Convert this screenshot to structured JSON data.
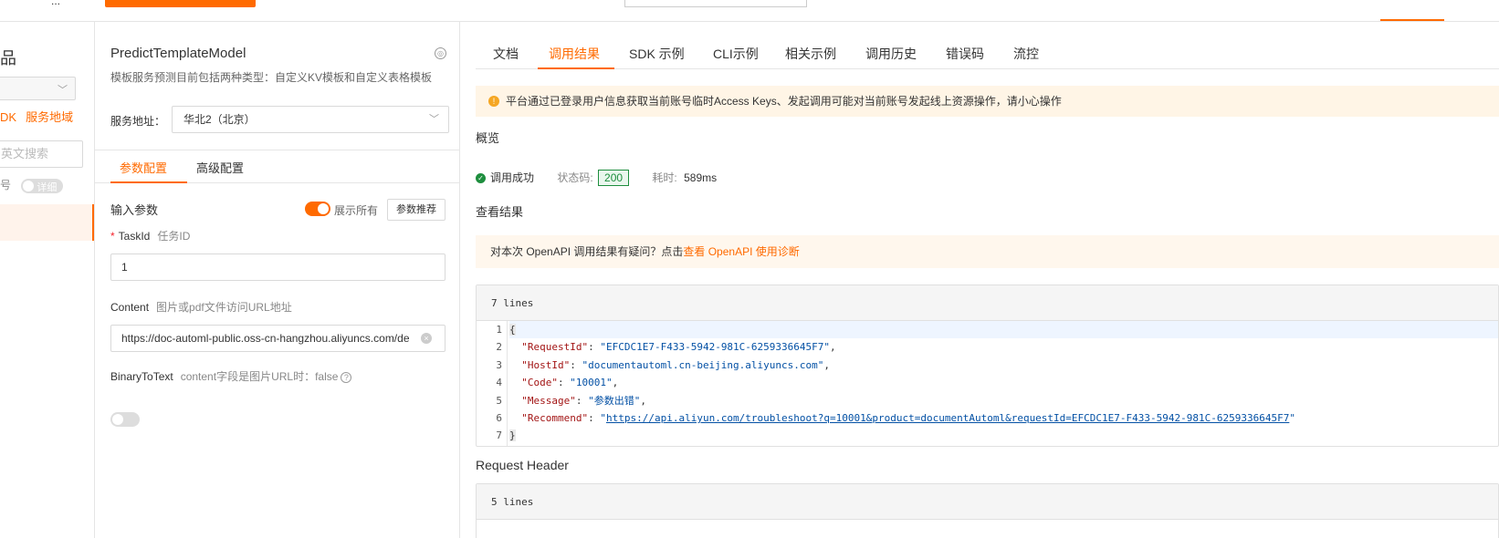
{
  "topbar": {
    "stub_text": "..."
  },
  "left": {
    "title_glyph": "品",
    "link_sdk": "DK",
    "link_region": "服务地域",
    "search_placeholder": "英文搜索",
    "toggle_left_label": "号",
    "toggle_label": "详细"
  },
  "api": {
    "name": "PredictTemplateModel",
    "description": "模板服务预测目前包括两种类型：自定义KV模板和自定义表格模板",
    "address_label": "服务地址：",
    "address_value": "华北2（北京）"
  },
  "param_tabs": {
    "params": "参数配置",
    "advanced": "高级配置"
  },
  "inputs": {
    "section_label": "输入参数",
    "show_all": "展示所有",
    "recommend": "参数推荐",
    "task_id": {
      "name": "TaskId",
      "hint": "任务ID",
      "value": "1"
    },
    "content": {
      "name": "Content",
      "hint": "图片或pdf文件访问URL地址",
      "value": "https://doc-automl-public.oss-cn-hangzhou.aliyuncs.com/de"
    },
    "binary": {
      "name": "BinaryToText",
      "hint": "content字段是图片URL时：false"
    }
  },
  "result_tabs": [
    "文档",
    "调用结果",
    "SDK 示例",
    "CLI示例",
    "相关示例",
    "调用历史",
    "错误码",
    "流控"
  ],
  "warning": "平台通过已登录用户信息获取当前账号临时Access Keys、发起调用可能对当前账号发起线上资源操作，请小心操作",
  "overview": {
    "title": "概览",
    "status": "调用成功",
    "status_code_label": "状态码:",
    "status_code": "200",
    "time_label": "耗时:",
    "time": "589ms"
  },
  "result": {
    "title": "查看结果",
    "hint_prefix": "对本次 OpenAPI 调用结果有疑问？点击",
    "hint_link": "查看 OpenAPI 使用诊断",
    "lines_label": "7 lines",
    "json": {
      "RequestId": "EFCDC1E7-F433-5942-981C-6259336645F7",
      "HostId": "documentautoml.cn-beijing.aliyuncs.com",
      "Code": "10001",
      "Message": "参数出错",
      "Recommend": "https://api.aliyun.com/troubleshoot?q=10001&product=documentAutoml&requestId=EFCDC1E7-F433-5942-981C-6259336645F7"
    }
  },
  "request_header": {
    "title": "Request Header",
    "lines_label": "5 lines"
  },
  "line_numbers": [
    "1",
    "2",
    "3",
    "4",
    "5",
    "6",
    "7"
  ],
  "colors": {
    "accent": "#ff6a00",
    "success": "#1e8e3e",
    "warning": "#f5a623"
  },
  "icons": [
    "chevron-down-icon",
    "api-info-icon",
    "clear-icon",
    "help-icon",
    "warning-icon",
    "success-icon"
  ]
}
